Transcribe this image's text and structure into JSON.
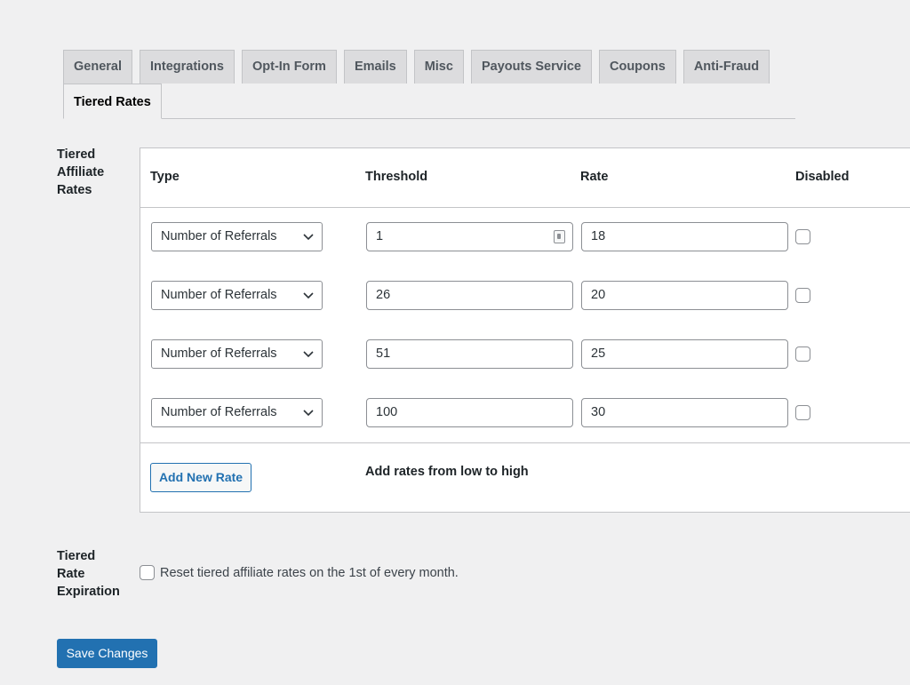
{
  "tabs": [
    {
      "label": "General",
      "active": false
    },
    {
      "label": "Integrations",
      "active": false
    },
    {
      "label": "Opt-In Form",
      "active": false
    },
    {
      "label": "Emails",
      "active": false
    },
    {
      "label": "Misc",
      "active": false
    },
    {
      "label": "Payouts Service",
      "active": false
    },
    {
      "label": "Coupons",
      "active": false
    },
    {
      "label": "Anti-Fraud",
      "active": false
    },
    {
      "label": "Tiered Rates",
      "active": true
    }
  ],
  "tiered_rates": {
    "label": "Tiered Affiliate Rates",
    "label_lines": [
      "Tiered",
      "Affiliate",
      "Rates"
    ],
    "columns": {
      "type": "Type",
      "threshold": "Threshold",
      "rate": "Rate",
      "disabled": "Disabled"
    },
    "rows": [
      {
        "type": "Number of Referrals",
        "threshold": "1",
        "rate": "18",
        "disabled": false
      },
      {
        "type": "Number of Referrals",
        "threshold": "26",
        "rate": "20",
        "disabled": false
      },
      {
        "type": "Number of Referrals",
        "threshold": "51",
        "rate": "25",
        "disabled": false
      },
      {
        "type": "Number of Referrals",
        "threshold": "100",
        "rate": "30",
        "disabled": false
      }
    ],
    "add_button": "Add New Rate",
    "hint": "Add rates from low to high"
  },
  "expiration": {
    "label_lines": [
      "Tiered",
      "Rate",
      "Expiration"
    ],
    "checkbox_label": "Reset tiered affiliate rates on the 1st of every month.",
    "checked": false
  },
  "save_button": "Save Changes"
}
